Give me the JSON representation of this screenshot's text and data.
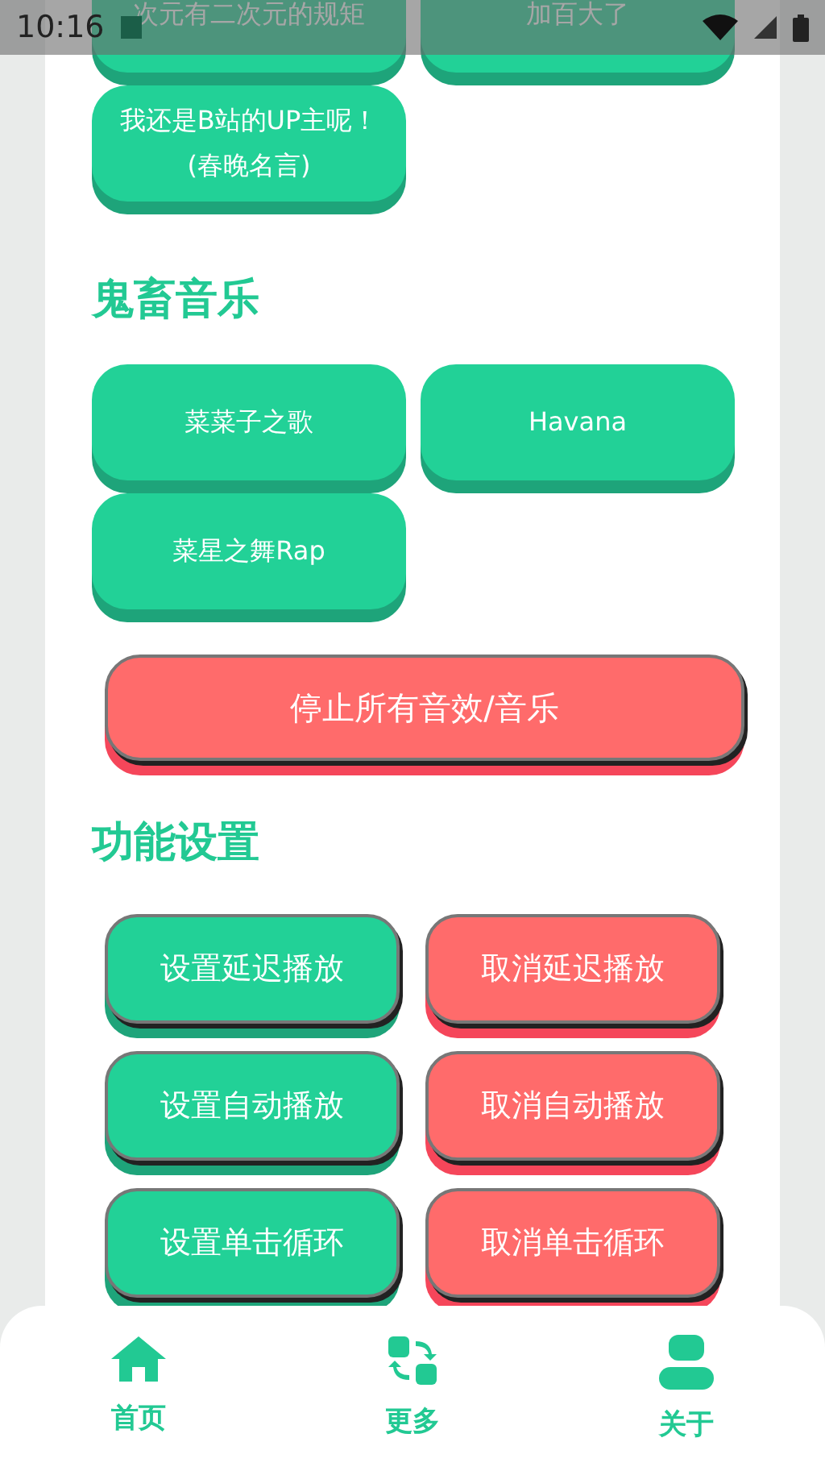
{
  "status_bar": {
    "time": "10:16"
  },
  "quote_buttons": [
    "次元有二次元的规矩",
    "加百大了",
    "我还是B站的UP主呢！\n(春晚名言)"
  ],
  "music_section": {
    "title": "鬼畜音乐",
    "buttons": [
      "菜菜子之歌",
      "Havana",
      "菜星之舞Rap"
    ]
  },
  "stop_button": "停止所有音效/音乐",
  "settings_section": {
    "title": "功能设置",
    "buttons": [
      {
        "label": "设置延迟播放",
        "kind": "set"
      },
      {
        "label": "取消延迟播放",
        "kind": "cancel"
      },
      {
        "label": "设置自动播放",
        "kind": "set"
      },
      {
        "label": "取消自动播放",
        "kind": "cancel"
      },
      {
        "label": "设置单击循环",
        "kind": "set"
      },
      {
        "label": "取消单击循环",
        "kind": "cancel"
      }
    ]
  },
  "nav": [
    {
      "label": "首页",
      "kind": "home"
    },
    {
      "label": "更多",
      "kind": "more"
    },
    {
      "label": "关于",
      "kind": "about"
    }
  ]
}
